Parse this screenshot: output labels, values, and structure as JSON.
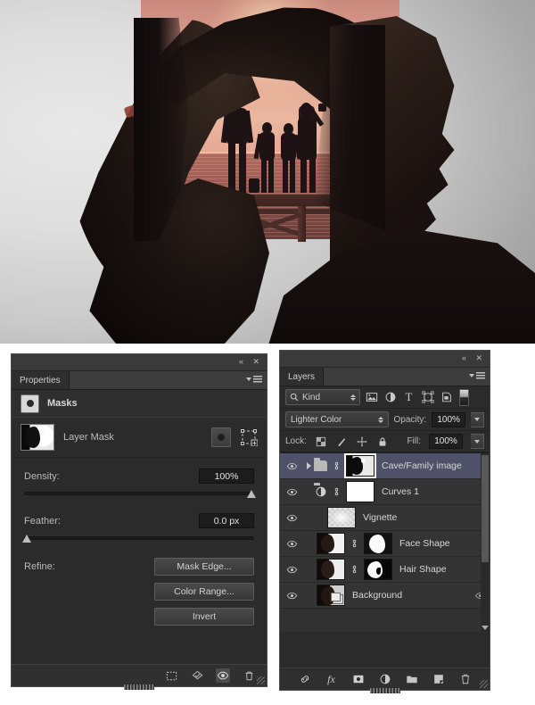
{
  "image": {
    "description": "Double-exposure photo: silhouette of a woman's profile with long hair; inside the head a cave opening frames a family of four silhouetted on a wooden pier at sunset over the sea",
    "subjects": [
      "woman-profile-silhouette",
      "father",
      "child-left",
      "child-right",
      "mother",
      "sun",
      "sea",
      "wooden-pier",
      "cave-opening"
    ],
    "colors": {
      "sky_top": "#c98a7e",
      "sky_mid": "#eab79f",
      "sun": "#fff8e8",
      "sea": "#96564f",
      "silhouette": "#1d1214",
      "backdrop_light": "#e9e9e9",
      "backdrop_dark": "#8f8f8f"
    }
  },
  "properties_panel": {
    "tab_label": "Properties",
    "collapse_icon": "«",
    "close_icon": "✕",
    "menu_icon": "panel-menu-icon",
    "section_title": "Masks",
    "section_icon": "pixel-mask-icon",
    "mask_row": {
      "label": "Layer Mask",
      "thumbnail": "layer-mask-thumbnail",
      "pixel_mask_button": "pixel-mask-button",
      "vector_mask_button": "vector-mask-button"
    },
    "density": {
      "label": "Density:",
      "value": "100%",
      "slider_pct": 100
    },
    "feather": {
      "label": "Feather:",
      "value": "0.0 px",
      "slider_pct": 0
    },
    "refine": {
      "label": "Refine:",
      "buttons": [
        {
          "label": "Mask Edge...",
          "name": "mask-edge-button"
        },
        {
          "label": "Color Range...",
          "name": "color-range-button"
        },
        {
          "label": "Invert",
          "name": "invert-button"
        }
      ]
    },
    "footer_icons": [
      {
        "name": "load-selection-icon",
        "glyph": "⬚",
        "active": false
      },
      {
        "name": "apply-mask-icon",
        "glyph": "⬡",
        "active": false
      },
      {
        "name": "toggle-mask-visibility-icon",
        "glyph": "◉",
        "active": true
      },
      {
        "name": "delete-mask-icon",
        "glyph": "🗑",
        "active": false
      }
    ]
  },
  "layers_panel": {
    "tab_label": "Layers",
    "collapse_icon": "«",
    "close_icon": "✕",
    "menu_icon": "panel-menu-icon",
    "filter": {
      "kind_label": "Kind",
      "search_icon": "search-icon",
      "type_filters": [
        {
          "name": "filter-pixel-layers-icon",
          "glyph": "⛰"
        },
        {
          "name": "filter-adjustment-layers-icon",
          "glyph": "◑"
        },
        {
          "name": "filter-type-layers-icon",
          "glyph": "T"
        },
        {
          "name": "filter-shape-layers-icon",
          "glyph": "⬜"
        },
        {
          "name": "filter-smart-objects-icon",
          "glyph": "❐"
        }
      ],
      "toggle_name": "filter-enable-toggle"
    },
    "blend_mode": "Lighter Color",
    "opacity": {
      "label": "Opacity:",
      "value": "100%"
    },
    "fill": {
      "label": "Fill:",
      "value": "100%"
    },
    "lock": {
      "label": "Lock:",
      "icons": [
        {
          "name": "lock-transparent-pixels-icon",
          "glyph": "▒"
        },
        {
          "name": "lock-image-pixels-icon",
          "glyph": "╱"
        },
        {
          "name": "lock-position-icon",
          "glyph": "✥"
        },
        {
          "name": "lock-all-icon",
          "glyph": "🔒"
        }
      ]
    },
    "layers": [
      {
        "name": "Cave/Family image",
        "selected": true,
        "visible": true,
        "type": "group",
        "has_expand_arrow": true,
        "has_folder_icon": true,
        "linked": true,
        "mask_selected": true,
        "thumb": "mask-cave-head"
      },
      {
        "name": "Curves 1",
        "selected": false,
        "visible": true,
        "type": "adjustment",
        "has_expand_arrow": false,
        "has_folder_icon": false,
        "linked": true,
        "mask_selected": false,
        "thumb": "white-mask"
      },
      {
        "name": "Vignette",
        "selected": false,
        "visible": true,
        "type": "pixel",
        "has_expand_arrow": false,
        "has_folder_icon": false,
        "linked": false,
        "mask_selected": false,
        "thumb": "checker-vignette"
      },
      {
        "name": "Face Shape",
        "selected": false,
        "visible": true,
        "type": "pixel",
        "has_expand_arrow": false,
        "has_folder_icon": false,
        "linked": true,
        "mask_selected": false,
        "thumb": "face-photo",
        "mask_thumb": "face-mask-white"
      },
      {
        "name": "Hair Shape",
        "selected": false,
        "visible": true,
        "type": "pixel",
        "has_expand_arrow": false,
        "has_folder_icon": false,
        "linked": true,
        "mask_selected": false,
        "thumb": "hair-photo",
        "mask_thumb": "hair-mask-white"
      },
      {
        "name": "Background",
        "selected": false,
        "visible": true,
        "type": "background",
        "has_expand_arrow": false,
        "has_folder_icon": false,
        "linked": false,
        "mask_selected": false,
        "thumb": "background-photo",
        "locked": true
      }
    ],
    "footer_icons": [
      {
        "name": "link-layers-icon",
        "glyph": "🔗"
      },
      {
        "name": "layer-style-fx-icon",
        "glyph": "fx"
      },
      {
        "name": "add-layer-mask-icon",
        "glyph": "◉"
      },
      {
        "name": "new-adjustment-layer-icon",
        "glyph": "◑"
      },
      {
        "name": "new-group-icon",
        "glyph": "📁"
      },
      {
        "name": "new-layer-icon",
        "glyph": "❐"
      },
      {
        "name": "delete-layer-icon",
        "glyph": "🗑"
      }
    ]
  },
  "accent": {
    "selection": "#4e5168",
    "panel_bg": "#2b2b2b",
    "row_bg": "#343434"
  }
}
